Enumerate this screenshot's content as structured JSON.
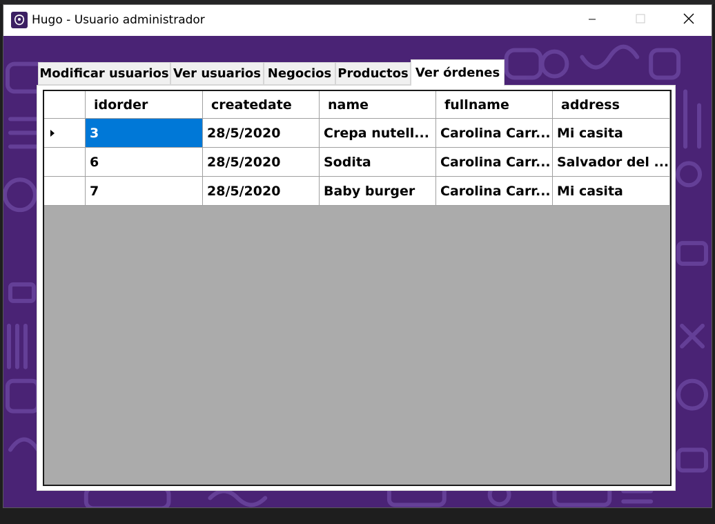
{
  "window": {
    "title": "Hugo - Usuario administrador",
    "icon": "hugo-logo-icon"
  },
  "title_controls": {
    "minimize_icon": "minimize-icon",
    "maximize_icon": "maximize-icon",
    "close_icon": "close-icon"
  },
  "tabs": [
    {
      "label": "Modificar usuarios",
      "active": false
    },
    {
      "label": "Ver usuarios",
      "active": false
    },
    {
      "label": "Negocios",
      "active": false
    },
    {
      "label": "Productos",
      "active": false
    },
    {
      "label": "Ver órdenes",
      "active": true
    }
  ],
  "grid": {
    "columns": [
      "idorder",
      "createdate",
      "name",
      "fullname",
      "address"
    ],
    "rows": [
      {
        "current": true,
        "cells": [
          "3",
          "28/5/2020",
          "Crepa nutell...",
          "Carolina Carr...",
          "Mi casita"
        ]
      },
      {
        "current": false,
        "cells": [
          "6",
          "28/5/2020",
          "Sodita",
          "Carolina Carr...",
          "Salvador del ..."
        ]
      },
      {
        "current": false,
        "cells": [
          "7",
          "28/5/2020",
          "Baby burger",
          "Carolina Carr...",
          "Mi casita"
        ]
      }
    ],
    "selected_cell": {
      "row": 0,
      "column": 0
    }
  },
  "colors": {
    "background_purple": "#4a2375",
    "selection_blue": "#0078d7",
    "grid_empty": "#ababab"
  }
}
